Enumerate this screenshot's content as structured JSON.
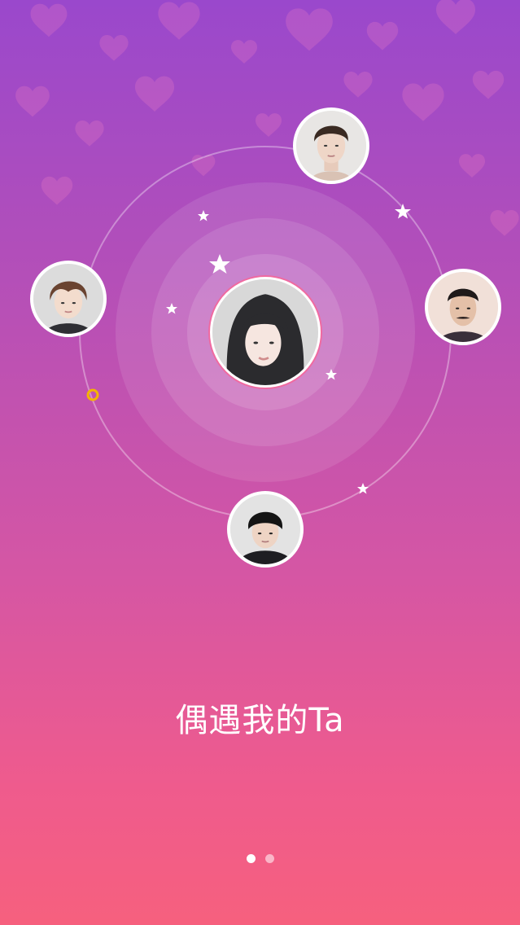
{
  "tagline": "偶遇我的Ta",
  "pagination": {
    "total": 2,
    "current": 1
  },
  "colors": {
    "gradient_top": "#9a48cc",
    "gradient_bottom": "#f6607e",
    "orbit_marker": "#f5b400"
  },
  "avatars": [
    {
      "id": "center",
      "icon": "woman-bob-haircut"
    },
    {
      "id": "top",
      "icon": "man-curly-hair"
    },
    {
      "id": "left",
      "icon": "man-brown-bangs"
    },
    {
      "id": "right",
      "icon": "man-mustache"
    },
    {
      "id": "bottom",
      "icon": "man-black-bangs"
    }
  ]
}
